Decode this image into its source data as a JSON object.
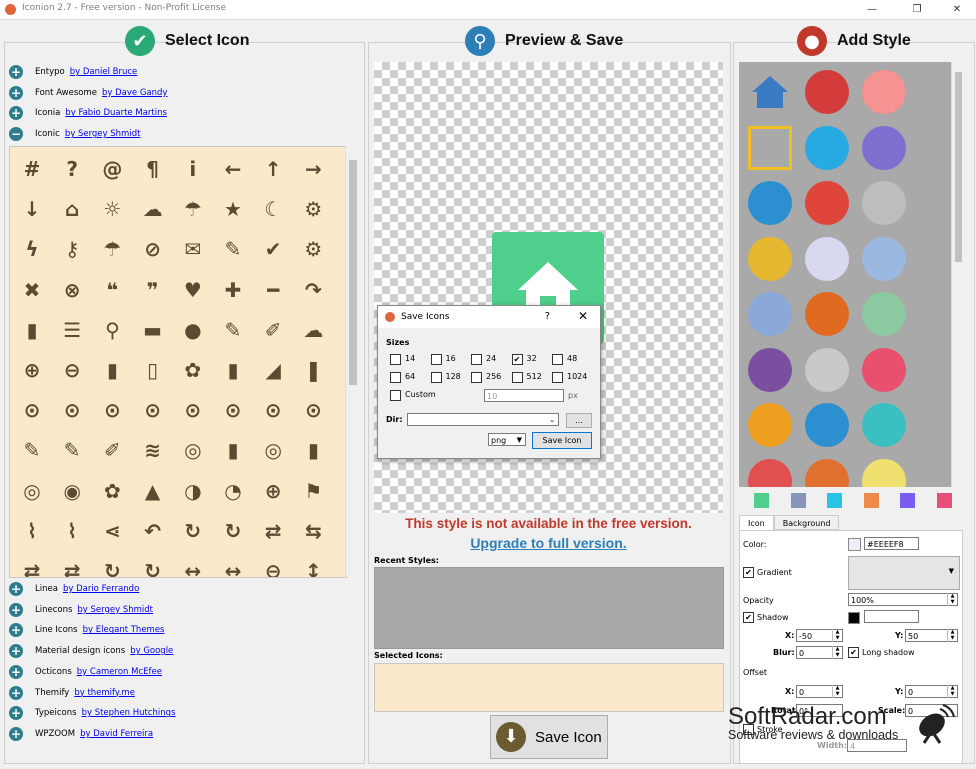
{
  "window": {
    "title": "Iconion 2.7 - Free version - Non-Profit License"
  },
  "panels": {
    "select": "Select Icon",
    "preview": "Preview & Save",
    "style": "Add Style"
  },
  "libraries_top": [
    {
      "name": "Entypo",
      "author": "by Daniel Bruce",
      "state": "+"
    },
    {
      "name": "Font Awesome",
      "author": "by Dave Gandy",
      "state": "+"
    },
    {
      "name": "Iconia",
      "author": "by Fabio Duarte Martins",
      "state": "+"
    },
    {
      "name": "Iconic",
      "author": "by Sergey Shmidt",
      "state": "−"
    }
  ],
  "libraries_bottom": [
    {
      "name": "Linea",
      "author": "by Dario Ferrando",
      "state": "+"
    },
    {
      "name": "Linecons",
      "author": "by Sergey Shmidt",
      "state": "+"
    },
    {
      "name": "Line Icons",
      "author": "by Elegant Themes",
      "state": "+"
    },
    {
      "name": "Material design icons",
      "author": "by Google",
      "state": "+"
    },
    {
      "name": "Octicons",
      "author": "by Cameron McEfee",
      "state": "+"
    },
    {
      "name": "Themify",
      "author": "by themify.me",
      "state": "+"
    },
    {
      "name": "Typeicons",
      "author": "by Stephen Hutchings",
      "state": "+"
    },
    {
      "name": "WPZOOM",
      "author": "by David Ferreira",
      "state": "+"
    }
  ],
  "icon_glyphs": [
    "#",
    "?",
    "@",
    "¶",
    "i",
    "←",
    "↑",
    "→",
    "↓",
    "⌂",
    "☼",
    "☁",
    "☂",
    "★",
    "☾",
    "⚙",
    "ϟ",
    "⚷",
    "☂",
    "⊘",
    "✉",
    "✎",
    "✔",
    "⚙",
    "✖",
    "⊗",
    "❝",
    "❞",
    "♥",
    "✚",
    "━",
    "↷",
    "▮",
    "☰",
    "⚲",
    "▬",
    "●",
    "✎",
    "✐",
    "☁",
    "⊕",
    "⊖",
    "▮",
    "▯",
    "✿",
    "▮",
    "◢",
    "❚",
    "⊙",
    "⊙",
    "⊙",
    "⊙",
    "⊙",
    "⊙",
    "⊙",
    "⊙",
    "✎",
    "✎",
    "✐",
    "≋",
    "◎",
    "▮",
    "◎",
    "▮",
    "◎",
    "◉",
    "✿",
    "▲",
    "◑",
    "◔",
    "⊕",
    "⚑",
    "⌇",
    "⌇",
    "⋖",
    "↶",
    "↻",
    "↻",
    "⇄",
    "⇆",
    "⇄",
    "⇄",
    "↻",
    "↻",
    "↔",
    "↔",
    "⊖",
    "↕"
  ],
  "dialog": {
    "title": "Save Icons",
    "help": "?",
    "close": "✕",
    "sizes_label": "Sizes",
    "sizes": [
      {
        "label": "14",
        "checked": false
      },
      {
        "label": "16",
        "checked": false
      },
      {
        "label": "24",
        "checked": false
      },
      {
        "label": "32",
        "checked": true
      },
      {
        "label": "48",
        "checked": false
      },
      {
        "label": "64",
        "checked": false
      },
      {
        "label": "128",
        "checked": false
      },
      {
        "label": "256",
        "checked": false
      },
      {
        "label": "512",
        "checked": false
      },
      {
        "label": "1024",
        "checked": false
      }
    ],
    "custom_label": "Custom",
    "custom_value": "10",
    "px": "px",
    "dir_label": "Dir:",
    "browse": "...",
    "format": "png",
    "save": "Save Icon"
  },
  "warning": "This style is not available in the free version.",
  "upgrade": "Upgrade to full version.",
  "recent_label": "Recent Styles:",
  "selected_label": "Selected Icons:",
  "save_icon": "Save Icon",
  "swatches": [
    "#4ecf8c",
    "#8a94b8",
    "#27c4e6",
    "#f08a4b",
    "#7b5cf0",
    "#e8507c"
  ],
  "tabs": [
    "Icon",
    "Background"
  ],
  "props": {
    "color_label": "Color:",
    "color_value": "#EEEEF8",
    "gradient_label": "Gradient",
    "opacity_label": "Opacity",
    "opacity_value": "100%",
    "shadow_label": "Shadow",
    "x_label": "X:",
    "x_value": "-50",
    "y_label": "Y:",
    "y_value": "50",
    "blur_label": "Blur:",
    "blur_value": "0",
    "long_shadow_label": "Long shadow",
    "offset_label": "Offset",
    "ox_value": "0",
    "oy_value": "0",
    "rotate_label": "Rotate:",
    "rotate_value": "0°",
    "scale_label": "Scale:",
    "scale_value": "0",
    "stroke_label": "Stroke",
    "width_label": "Width:",
    "width_value": "4"
  },
  "watermark": {
    "line1": "SoftRadar.com",
    "line2": "Software reviews & downloads"
  }
}
